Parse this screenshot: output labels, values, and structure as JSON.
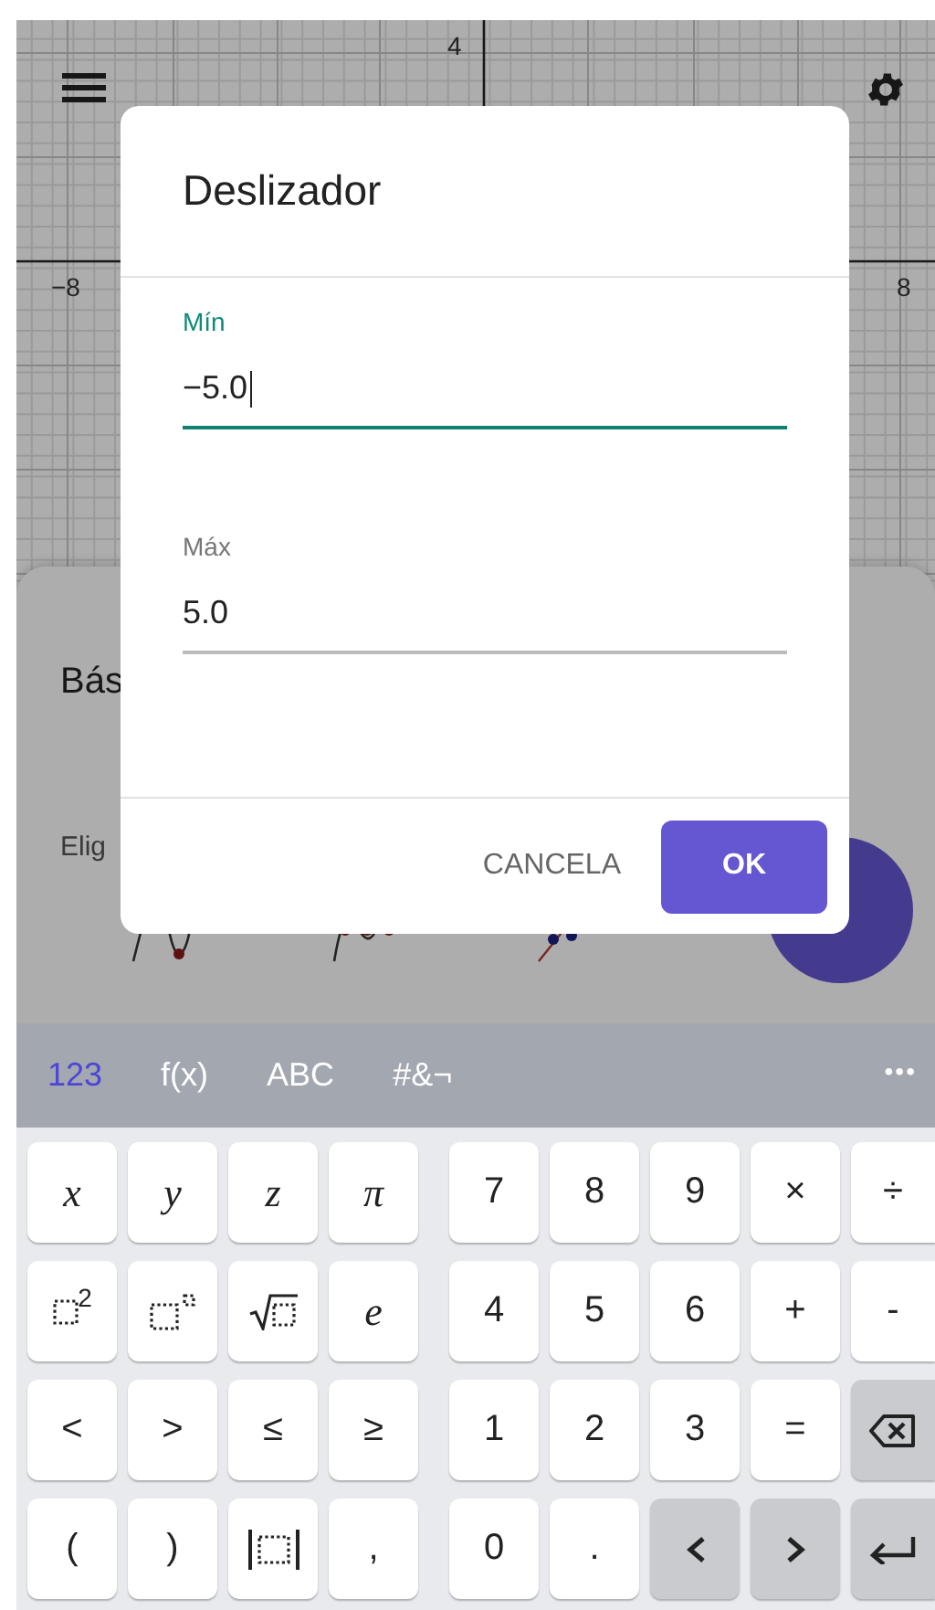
{
  "graph": {
    "axis_labels": [
      "4",
      "−8",
      "8"
    ]
  },
  "sheet": {
    "title": "Bás",
    "subtitle": "Elig"
  },
  "dialog": {
    "title": "Deslizador",
    "fields": [
      {
        "label": "Mín",
        "value": "−5.0",
        "focused": true
      },
      {
        "label": "Máx",
        "value": "5.0",
        "focused": false
      }
    ],
    "buttons": [
      {
        "label": "CANCELA",
        "kind": "text"
      },
      {
        "label": "OK",
        "kind": "filled"
      }
    ]
  },
  "keyboard": {
    "tabs": [
      {
        "label": "123",
        "selected": true
      },
      {
        "label": "f(x)",
        "selected": false
      },
      {
        "label": "ABC",
        "selected": false
      },
      {
        "label": "#&¬",
        "selected": false
      }
    ],
    "more": "•••",
    "rows": [
      [
        {
          "kind": "var",
          "label": "x",
          "dark": false
        },
        {
          "kind": "var",
          "label": "y",
          "dark": false
        },
        {
          "kind": "var",
          "label": "z",
          "dark": false
        },
        {
          "kind": "var",
          "label": "π",
          "dark": false
        },
        {
          "kind": "key",
          "label": "7",
          "dark": false
        },
        {
          "kind": "key",
          "label": "8",
          "dark": false
        },
        {
          "kind": "key",
          "label": "9",
          "dark": false
        },
        {
          "kind": "key",
          "label": "×",
          "dark": false
        },
        {
          "kind": "key",
          "label": "÷",
          "dark": false
        }
      ],
      [
        {
          "kind": "power",
          "label": "2",
          "dark": false
        },
        {
          "kind": "power-box",
          "dark": false
        },
        {
          "kind": "sqrt",
          "dark": false
        },
        {
          "kind": "var",
          "label": "e",
          "dark": false
        },
        {
          "kind": "key",
          "label": "4",
          "dark": false
        },
        {
          "kind": "key",
          "label": "5",
          "dark": false
        },
        {
          "kind": "key",
          "label": "6",
          "dark": false
        },
        {
          "kind": "key",
          "label": "+",
          "dark": false
        },
        {
          "kind": "key",
          "label": "-",
          "dark": false
        }
      ],
      [
        {
          "kind": "key",
          "label": "<",
          "dark": false
        },
        {
          "kind": "key",
          "label": ">",
          "dark": false
        },
        {
          "kind": "key",
          "label": "≤",
          "dark": false
        },
        {
          "kind": "key",
          "label": "≥",
          "dark": false
        },
        {
          "kind": "key",
          "label": "1",
          "dark": false
        },
        {
          "kind": "key",
          "label": "2",
          "dark": false
        },
        {
          "kind": "key",
          "label": "3",
          "dark": false
        },
        {
          "kind": "key",
          "label": "=",
          "dark": false
        },
        {
          "kind": "backspace",
          "dark": true
        }
      ],
      [
        {
          "kind": "key",
          "label": "(",
          "dark": false
        },
        {
          "kind": "key",
          "label": ")",
          "dark": false
        },
        {
          "kind": "abs",
          "dark": false
        },
        {
          "kind": "key",
          "label": ",",
          "dark": false
        },
        {
          "kind": "key",
          "label": "0",
          "dark": false
        },
        {
          "kind": "key",
          "label": ".",
          "dark": false
        },
        {
          "kind": "left",
          "dark": true
        },
        {
          "kind": "right",
          "dark": true
        },
        {
          "kind": "enter",
          "dark": true
        }
      ]
    ]
  }
}
